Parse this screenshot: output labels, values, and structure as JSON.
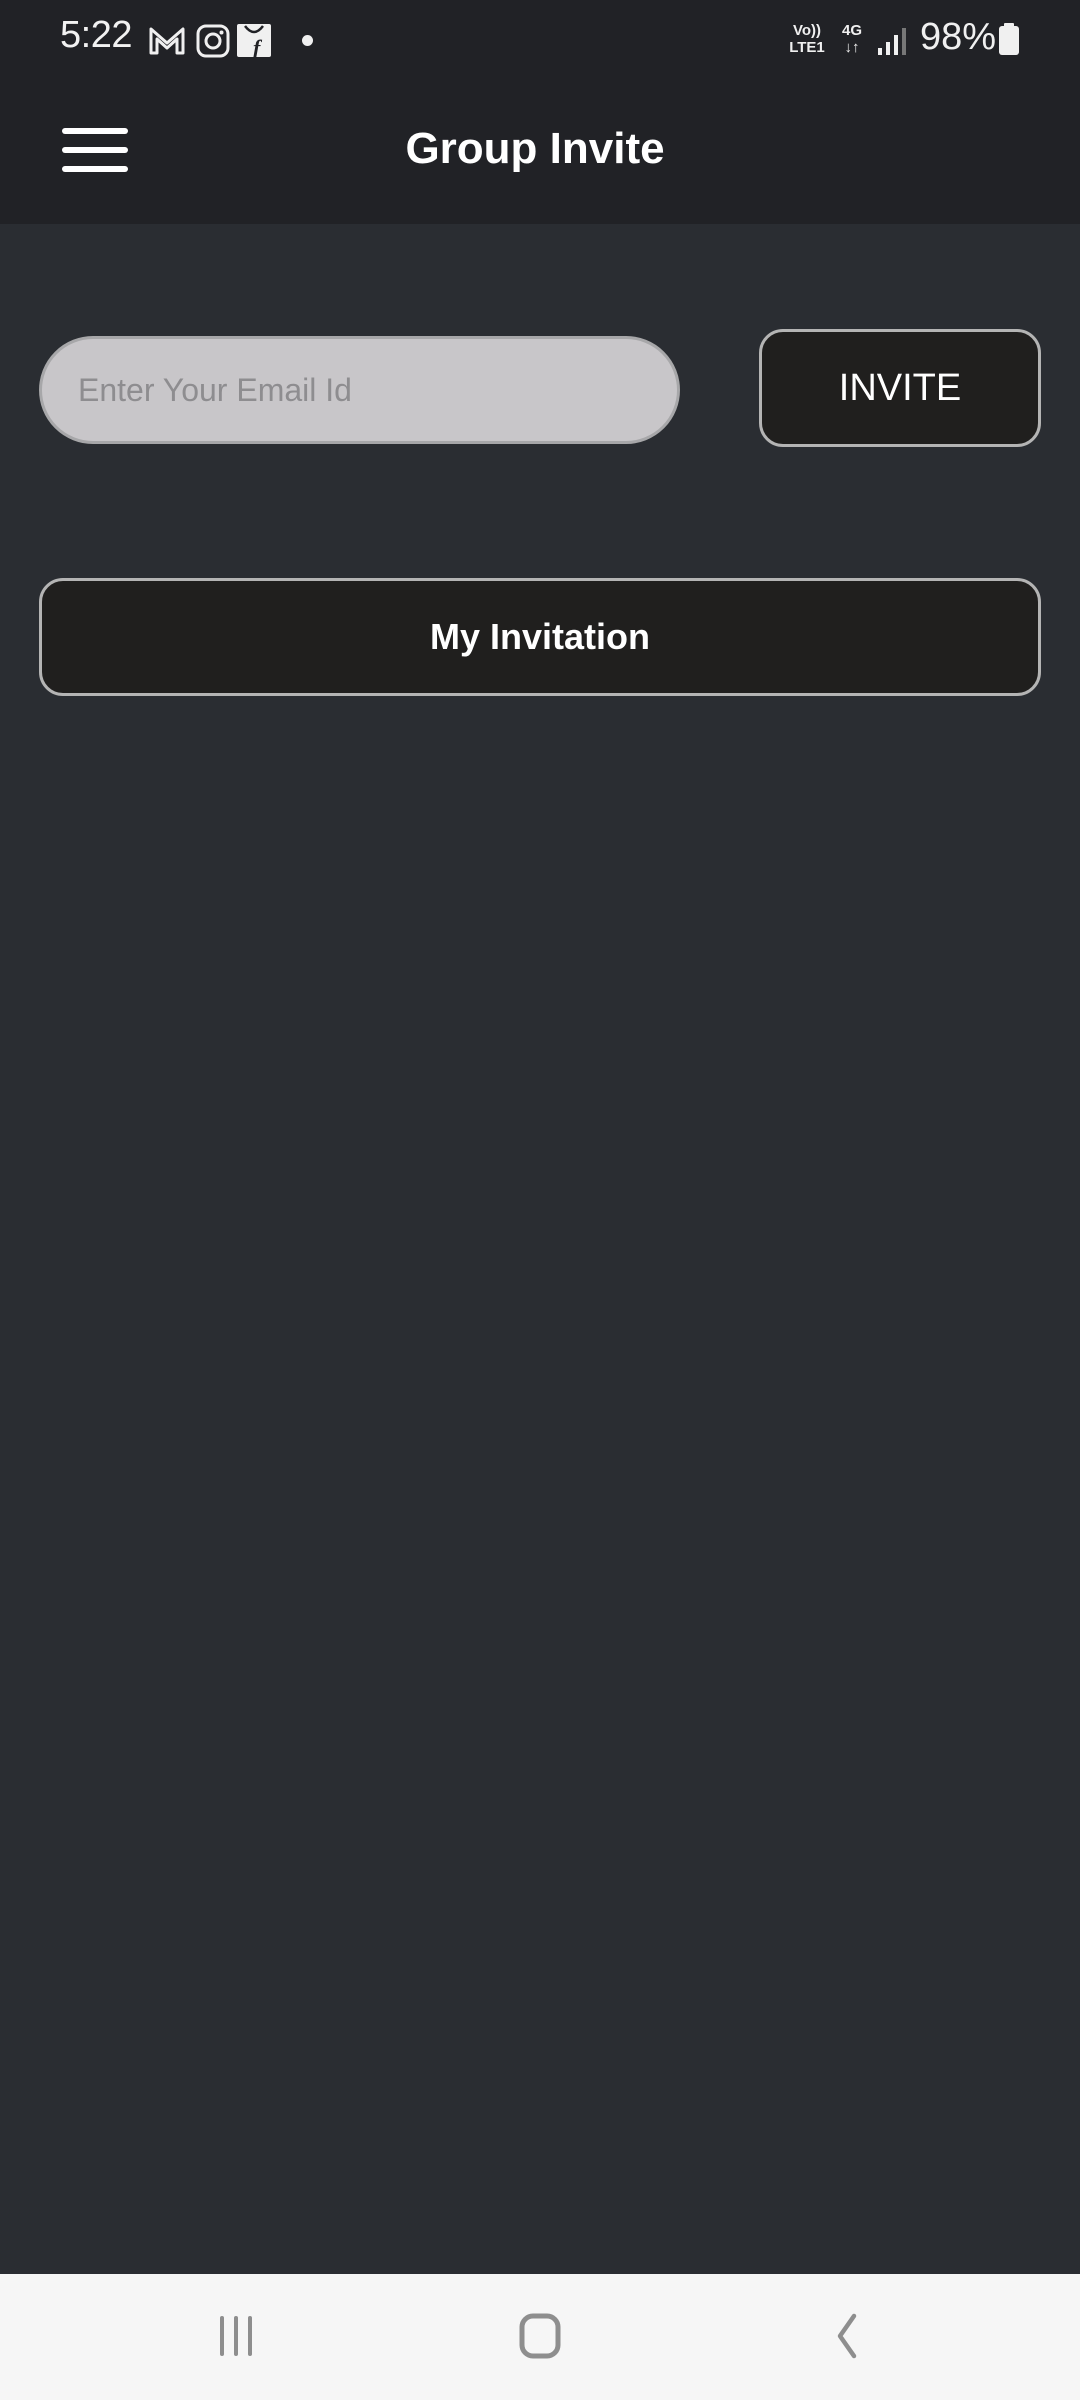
{
  "status_bar": {
    "time": "5:22",
    "notification_icons": [
      "gmail-icon",
      "instagram-icon",
      "flipkart-icon",
      "more-notifications-dot"
    ],
    "volte": "Vo))",
    "lte": "LTE1",
    "network": "4G",
    "battery_percent": "98%",
    "battery_level": 0.98
  },
  "app_bar": {
    "title": "Group Invite",
    "menu_icon": "hamburger-menu-icon"
  },
  "invite_form": {
    "email_value": "",
    "email_placeholder": "Enter Your Email Id",
    "invite_label": "INVITE"
  },
  "my_invitation": {
    "label": "My Invitation"
  },
  "nav_bar": {
    "items": [
      "recent-apps-icon",
      "home-icon",
      "back-icon"
    ]
  },
  "colors": {
    "bar_bg": "#212226",
    "content_bg": "#2a2d32",
    "button_bg": "#201f1e",
    "input_bg": "#c8c6c9",
    "nav_bg": "#f6f6f6"
  }
}
